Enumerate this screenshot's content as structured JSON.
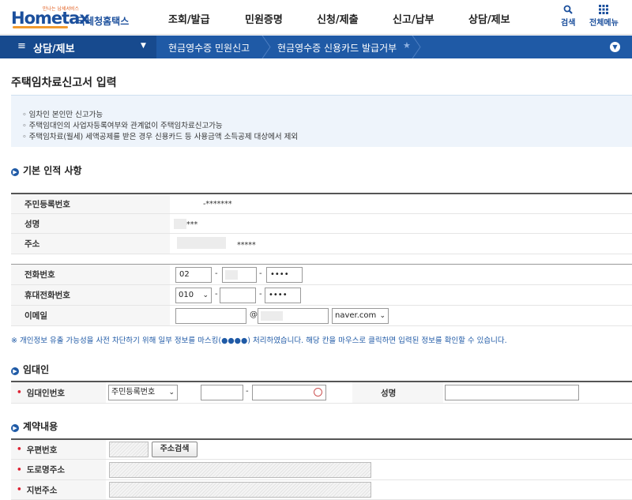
{
  "header": {
    "logo_tag": "만나는 납세서비스",
    "logo_main": "Hometax",
    "logo_sub": "국세청홈택스",
    "nav": [
      "조회/발급",
      "민원증명",
      "신청/제출",
      "신고/납부",
      "상담/제보"
    ],
    "search_label": "검색",
    "menu_label": "전체메뉴"
  },
  "breadcrumb": {
    "menu_label": "상담/제보",
    "item1": "현금영수증 민원신고",
    "item2": "현금영수증 신용카드 발급거부"
  },
  "page_title": "주택임차료신고서 입력",
  "notice": [
    "임차인 본인만 신고가능",
    "주택임대인의 사업자등록여부와 관계없이 주택임차료신고가능",
    "주택임차료(월세) 세액공제를 받은 경우 신용카드 등 사용금액 소득공제 대상에서 제외"
  ],
  "basic": {
    "title": "기본 인적 사항",
    "rrn_label": "주민등록번호",
    "rrn_value": "-*******",
    "name_label": "성명",
    "name_value": "***",
    "addr_label": "주소",
    "addr_value": "*****",
    "phone_label": "전화번호",
    "phone1": "02",
    "phone3": "••••",
    "mobile_label": "휴대전화번호",
    "mobile1": "010",
    "mobile3": "••••",
    "email_label": "이메일",
    "email_at": "@",
    "email_domain": "naver.com"
  },
  "privacy_note": "※ 개인정보 유출 가능성을 사전 차단하기 위해 일부 정보를 마스킹(●●●●) 처리하였습니다. 해당 칸을 마우스로 클릭하면 입력된 정보를 확인할 수 있습니다.",
  "landlord": {
    "title": "임대인",
    "id_label": "임대인번호",
    "id_type": "주민등록번호",
    "name_label": "성명"
  },
  "contract": {
    "title": "계약내용",
    "zip_label": "우편번호",
    "search_button": "주소검색",
    "road_label": "도로명주소",
    "lot_label": "지번주소"
  }
}
